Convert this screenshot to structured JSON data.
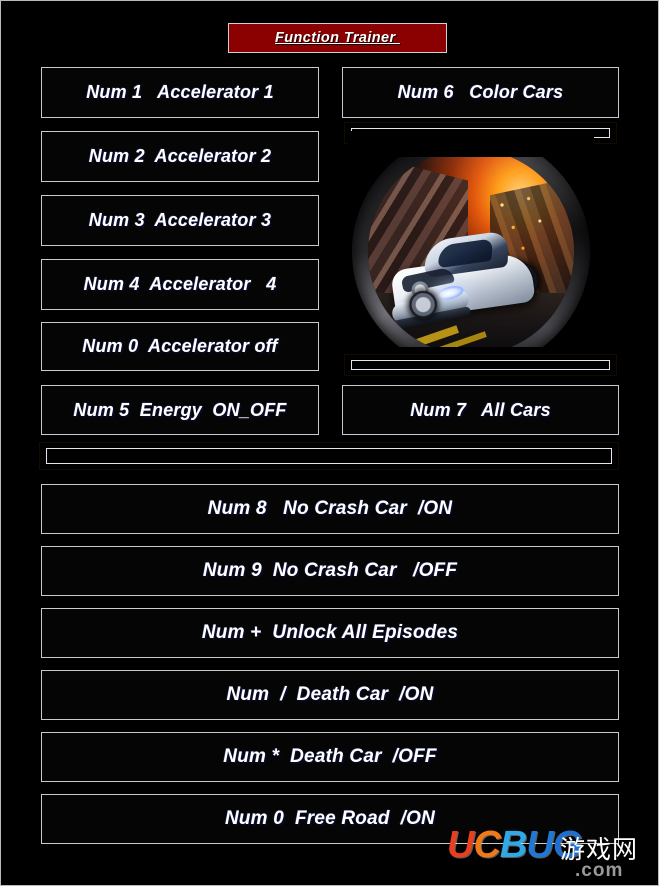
{
  "window": {
    "title": "Function Trainer ",
    "background_color": "#000000",
    "border_color": "#b9b9c2",
    "title_bg_color": "#8b0101",
    "title_text_color": "#ffffff"
  },
  "theme": {
    "button_bg": "#050505",
    "button_border": "#c9c9cf",
    "button_text": "#ffffff",
    "gold_accent": "#f0ae16",
    "gold_dark": "#3d1d02"
  },
  "left_column": {
    "buttons": [
      {
        "label": "Num 1   Accelerator 1"
      },
      {
        "label": "Num 2  Accelerator 2"
      },
      {
        "label": "Num 3  Accelerator 3"
      },
      {
        "label": "Num 4  Accelerator   4"
      },
      {
        "label": "Num 0  Accelerator off"
      },
      {
        "label": "Num 5  Energy  ON_OFF"
      }
    ]
  },
  "right_column": {
    "buttons": [
      {
        "label": "Num 6   Color Cars"
      },
      {
        "label": "Num 7   All Cars"
      }
    ],
    "game_icon": {
      "name": "racing-game-circular-icon",
      "description": "White sports car with fire explosion, circular bezel"
    }
  },
  "dividers": [
    {
      "name": "gold-divider-top-right"
    },
    {
      "name": "gold-divider-bottom-right"
    },
    {
      "name": "gold-divider-full-width"
    }
  ],
  "bottom_section": {
    "buttons": [
      {
        "label": "Num 8   No Crash Car  /ON"
      },
      {
        "label": "Num 9  No Crash Car   /OFF"
      },
      {
        "label": "Num +  Unlock All Episodes"
      },
      {
        "label": "Num  /  Death Car  /ON"
      },
      {
        "label": "Num *  Death Car  /OFF"
      },
      {
        "label": "Num 0  Free Road  /ON"
      }
    ]
  },
  "watermark": {
    "u": "U",
    "c": "C",
    "b": "B",
    "u2": "U",
    "g": "G",
    "cn": "游戏网",
    "com": ".com"
  }
}
